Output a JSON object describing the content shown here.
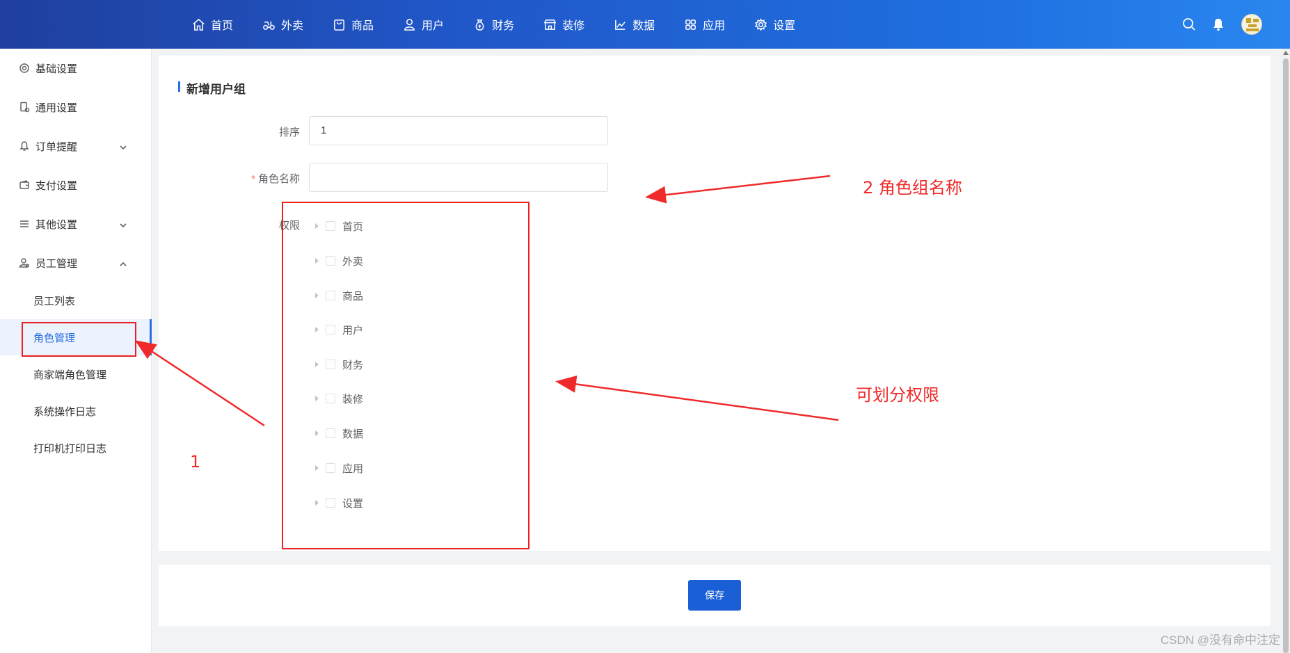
{
  "topnav": {
    "items": [
      {
        "label": "首页",
        "icon": "home-icon"
      },
      {
        "label": "外卖",
        "icon": "scooter-icon"
      },
      {
        "label": "商品",
        "icon": "bag-icon"
      },
      {
        "label": "用户",
        "icon": "user-icon"
      },
      {
        "label": "财务",
        "icon": "money-bag-icon"
      },
      {
        "label": "装修",
        "icon": "store-icon"
      },
      {
        "label": "数据",
        "icon": "chart-icon"
      },
      {
        "label": "应用",
        "icon": "apps-icon"
      },
      {
        "label": "设置",
        "icon": "gear-icon"
      }
    ]
  },
  "sidebar": {
    "items": [
      {
        "label": "基础设置"
      },
      {
        "label": "通用设置"
      },
      {
        "label": "订单提醒"
      },
      {
        "label": "支付设置"
      },
      {
        "label": "其他设置"
      },
      {
        "label": "员工管理"
      }
    ],
    "sub_items": [
      {
        "label": "员工列表"
      },
      {
        "label": "角色管理"
      },
      {
        "label": "商家端角色管理"
      },
      {
        "label": "系统操作日志"
      },
      {
        "label": "打印机打印日志"
      }
    ]
  },
  "form": {
    "title": "新增用户组",
    "sort_label": "排序",
    "sort_value": "1",
    "name_required_mark": "*",
    "name_label": "角色名称",
    "name_value": "",
    "perm_label": "权限",
    "permissions": [
      "首页",
      "外卖",
      "商品",
      "用户",
      "财务",
      "装修",
      "数据",
      "应用",
      "设置"
    ]
  },
  "footer": {
    "save_label": "保存"
  },
  "annotations": {
    "label_1": "1",
    "label_2": "2  角色组名称",
    "label_3": "可划分权限",
    "color": "#f02a2a"
  },
  "watermark": "CSDN @没有命中注定",
  "colors": {
    "primary": "#2a6fe0",
    "button": "#1a5fd6",
    "topbar_start": "#1f3f9e",
    "topbar_end": "#2a86ef",
    "active_bg": "#ecf3fe",
    "required": "#f56c6c"
  }
}
